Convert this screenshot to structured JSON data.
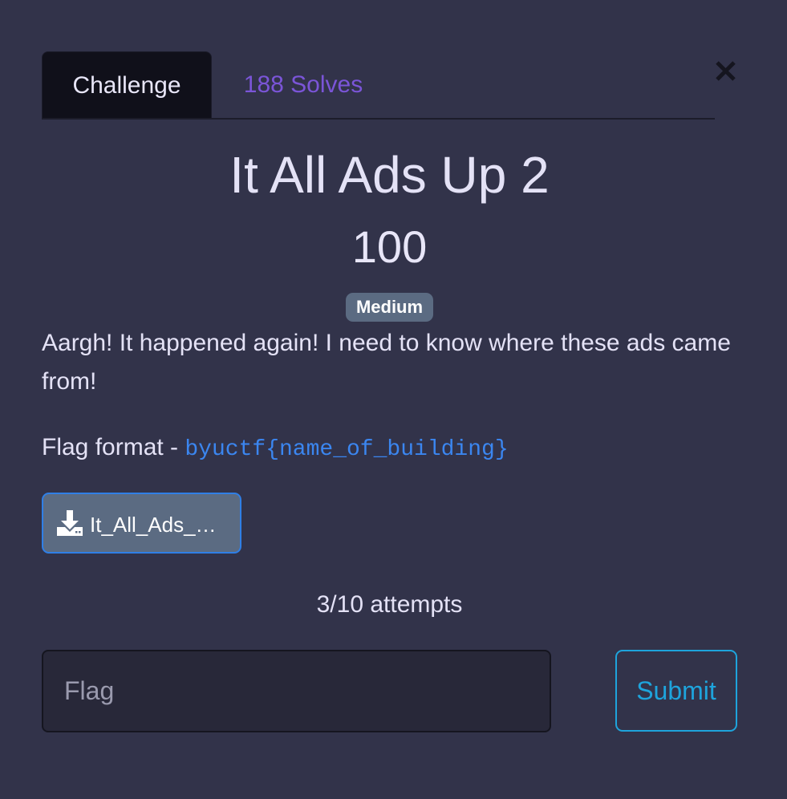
{
  "tabs": [
    {
      "label": "Challenge",
      "active": true
    },
    {
      "label": "188 Solves",
      "active": false
    }
  ],
  "challenge": {
    "title": "It All Ads Up 2",
    "points": "100",
    "difficulty": "Medium",
    "description": "Aargh! It happened again! I need to know where these ads came from!",
    "flag_format_prefix": "Flag format - ",
    "flag_format_code": "byuctf{name_of_building}"
  },
  "download": {
    "label": "It_All_Ads_…",
    "icon": "download-icon"
  },
  "attempts": "3/10 attempts",
  "submission": {
    "placeholder": "Flag",
    "value": "",
    "submit_label": "Submit"
  },
  "colors": {
    "background": "#32334a",
    "tab_active_bg": "#10101a",
    "solves_tab_text": "#7b55d8",
    "badge_bg": "#5b6b82",
    "code_text": "#3b86f0",
    "submit_accent": "#1ea4dc",
    "download_border": "#2f7fe6"
  }
}
